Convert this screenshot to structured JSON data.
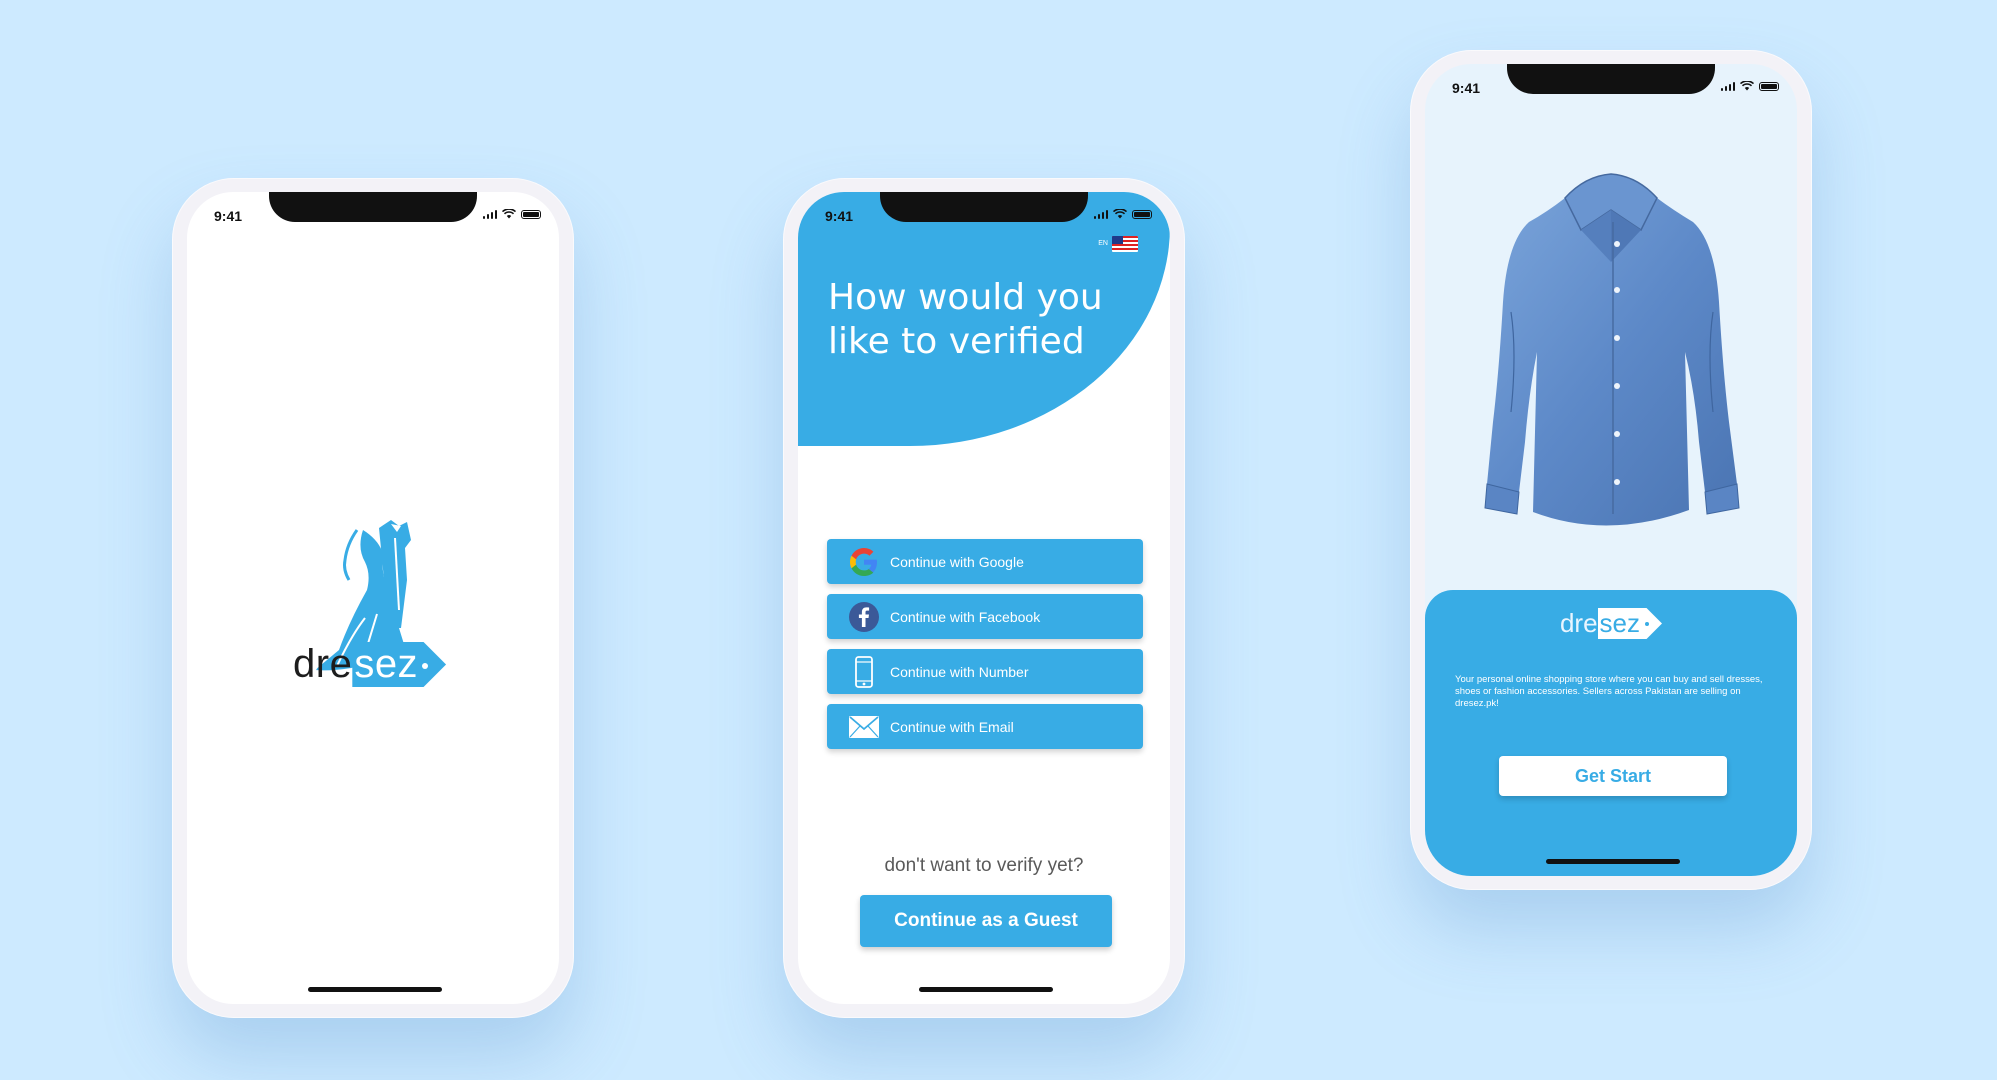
{
  "status_time": "9:41",
  "splash": {
    "brand_prefix": "dre",
    "brand_tag": "sez"
  },
  "verify": {
    "title": "How would you like to verified",
    "language": "EN",
    "methods": [
      {
        "label": "Continue with Google",
        "icon": "google-icon"
      },
      {
        "label": "Continue with Facebook",
        "icon": "facebook-icon"
      },
      {
        "label": "Continue with Number",
        "icon": "phone-icon"
      },
      {
        "label": "Continue with Email",
        "icon": "mail-icon"
      }
    ],
    "guest_question": "don't want to verify yet?",
    "guest_button": "Continue as a Guest"
  },
  "intro": {
    "brand_prefix": "dre",
    "brand_tag": "sez",
    "description": "Your personal online shopping store where you can buy and sell dresses, shoes or fashion accessories. Sellers across Pakistan are selling on dresez.pk!",
    "start_button": "Get Start"
  },
  "colors": {
    "background": "#cdeaff",
    "accent": "#38ace5"
  }
}
